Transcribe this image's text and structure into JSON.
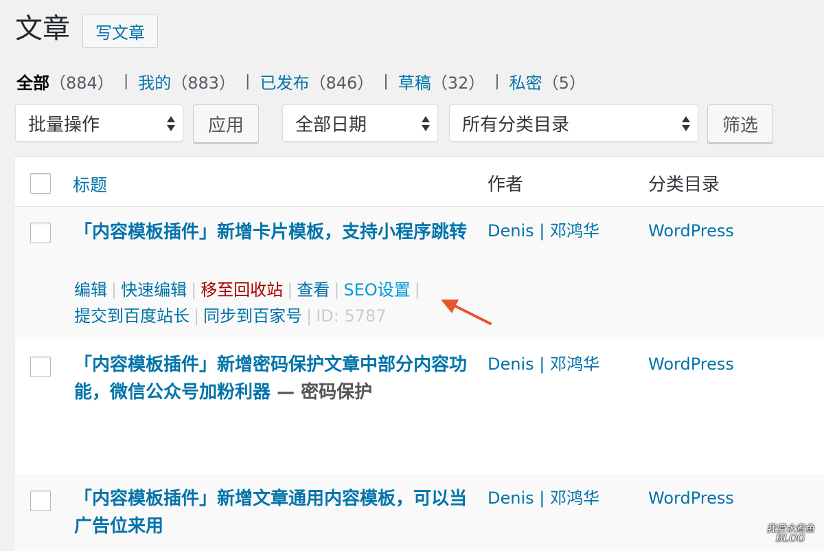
{
  "header": {
    "title": "文章",
    "add_new_label": "写文章"
  },
  "filters": {
    "all": {
      "label": "全部",
      "count": "（884）"
    },
    "mine": {
      "label": "我的",
      "count": "（883）"
    },
    "published": {
      "label": "已发布",
      "count": "（846）"
    },
    "drafts": {
      "label": "草稿",
      "count": "（32）"
    },
    "private": {
      "label": "私密",
      "count": "（5）"
    }
  },
  "tablenav": {
    "bulk_action": "批量操作",
    "apply_label": "应用",
    "date_filter": "全部日期",
    "category_filter": "所有分类目录",
    "filter_label": "筛选"
  },
  "table": {
    "columns": {
      "title": "标题",
      "author": "作者",
      "categories": "分类目录"
    },
    "rows": [
      {
        "title": "「内容模板插件」新增卡片模板，支持小程序跳转",
        "state": "",
        "author": "Denis | 邓鸿华",
        "category": "WordPress",
        "actions": {
          "edit": "编辑",
          "quick_edit": "快速编辑",
          "trash": "移至回收站",
          "view": "查看",
          "seo": "SEO设置",
          "baidu": "提交到百度站长",
          "sync": "同步到百家号",
          "id": "ID: 5787"
        }
      },
      {
        "title": "「内容模板插件」新增密码保护文章中部分内容功能，微信公众号加粉利器",
        "state": " — 密码保护",
        "author": "Denis | 邓鸿华",
        "category": "WordPress"
      },
      {
        "title": "「内容模板插件」新增文章通用内容模板，可以当广告位来用",
        "state": "",
        "author": "Denis | 邓鸿华",
        "category": "WordPress"
      }
    ]
  },
  "annotation": {
    "arrow_color": "#e8542f",
    "icon": "annotation-arrow-icon"
  },
  "watermark": {
    "line1": "我爱水煮鱼",
    "line2": "BLOG"
  }
}
